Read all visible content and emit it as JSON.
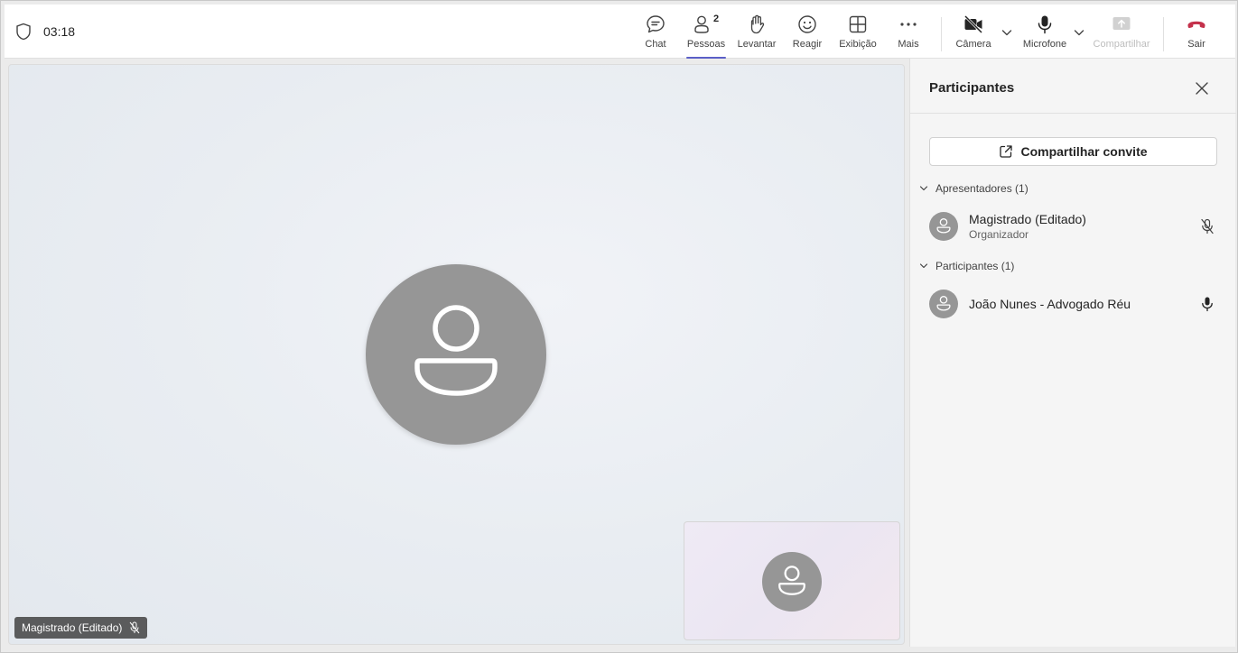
{
  "header": {
    "timer": "03:18",
    "buttons": {
      "chat": "Chat",
      "people": "Pessoas",
      "people_count": "2",
      "raise": "Levantar",
      "react": "Reagir",
      "view": "Exibição",
      "more": "Mais",
      "camera": "Câmera",
      "mic": "Microfone",
      "share": "Compartilhar",
      "leave": "Sair"
    }
  },
  "stage": {
    "name_tag": "Magistrado (Editado)"
  },
  "panel": {
    "title": "Participantes",
    "invite_label": "Compartilhar convite",
    "sections": [
      {
        "header": "Apresentadores (1)",
        "people": [
          {
            "name": "Magistrado (Editado)",
            "role": "Organizador",
            "mic": "muted"
          }
        ]
      },
      {
        "header": "Participantes (1)",
        "people": [
          {
            "name": "João Nunes - Advogado Réu",
            "role": "",
            "mic": "on"
          }
        ]
      }
    ]
  },
  "colors": {
    "accent": "#5b5fc7",
    "leave": "#c4314b",
    "avatar": "#969696"
  },
  "icons": [
    "shield-icon",
    "chat-icon",
    "people-icon",
    "hand-icon",
    "emoji-icon",
    "grid-icon",
    "more-icon",
    "camera-off-icon",
    "chevron-down-icon",
    "microphone-icon",
    "share-icon",
    "phone-hangup-icon",
    "close-icon",
    "share-invite-icon",
    "mic-off-icon",
    "person-icon"
  ]
}
